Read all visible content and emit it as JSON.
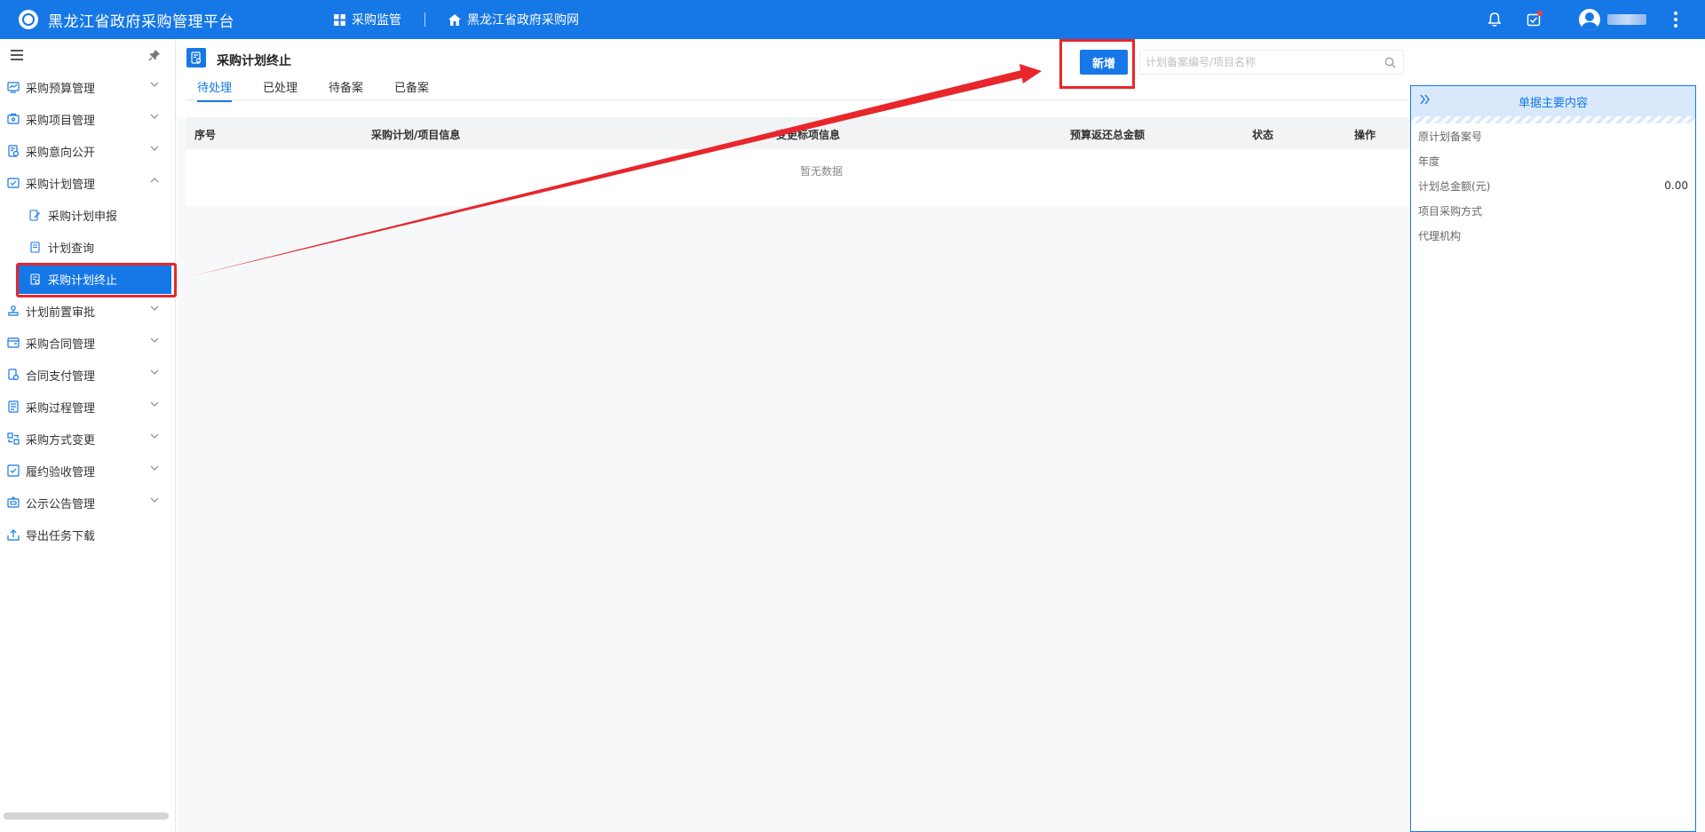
{
  "app": {
    "title": "黑龙江省政府采购管理平台"
  },
  "topnav": [
    {
      "label": "采购监管",
      "icon": "grid-icon"
    },
    {
      "label": "黑龙江省政府采购网",
      "icon": "home-icon"
    }
  ],
  "sidebar": {
    "items": [
      {
        "label": "采购预算管理",
        "icon": "budget-icon"
      },
      {
        "label": "采购项目管理",
        "icon": "project-icon"
      },
      {
        "label": "采购意向公开",
        "icon": "intent-icon"
      },
      {
        "label": "采购计划管理",
        "icon": "plan-icon"
      },
      {
        "label": "计划前置审批",
        "icon": "approval-icon"
      },
      {
        "label": "采购合同管理",
        "icon": "contract-icon"
      },
      {
        "label": "合同支付管理",
        "icon": "payment-icon"
      },
      {
        "label": "采购过程管理",
        "icon": "process-icon"
      },
      {
        "label": "采购方式变更",
        "icon": "method-icon"
      },
      {
        "label": "履约验收管理",
        "icon": "acceptance-icon"
      },
      {
        "label": "公示公告管理",
        "icon": "notice-icon"
      },
      {
        "label": "导出任务下载",
        "icon": "export-icon"
      }
    ],
    "subitems": [
      {
        "label": "采购计划申报"
      },
      {
        "label": "计划查询"
      },
      {
        "label": "采购计划终止"
      }
    ]
  },
  "page": {
    "title": "采购计划终止",
    "tabs": [
      {
        "label": "待处理"
      },
      {
        "label": "已处理"
      },
      {
        "label": "待备案"
      },
      {
        "label": "已备案"
      }
    ],
    "add_label": "新增",
    "search_placeholder": "计划备案编号/项目名称"
  },
  "table": {
    "columns": [
      "序号",
      "采购计划/项目信息",
      "变更标项信息",
      "预算返还总金额",
      "状态",
      "操作"
    ],
    "empty_text": "暂无数据"
  },
  "rpanel": {
    "title": "单据主要内容",
    "rows": [
      {
        "label": "原计划备案号",
        "value": ""
      },
      {
        "label": "年度",
        "value": ""
      },
      {
        "label": "计划总金额(元)",
        "value": "0.00"
      },
      {
        "label": "项目采购方式",
        "value": ""
      },
      {
        "label": "代理机构",
        "value": ""
      }
    ]
  },
  "colors": {
    "primary": "#1677e6",
    "annotation_red": "#e8262b"
  }
}
